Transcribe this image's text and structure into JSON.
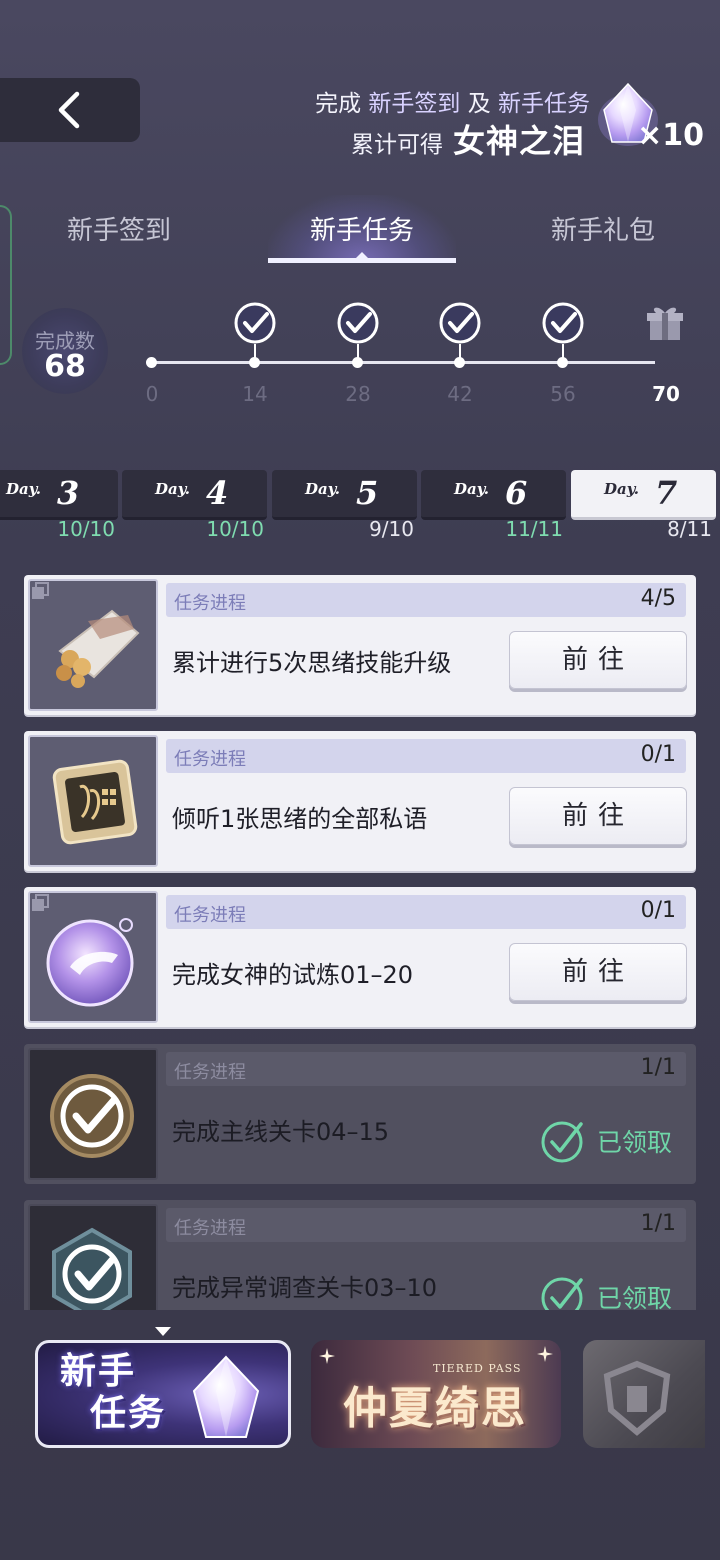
{
  "header": {
    "banner_line1_prefix": "完成",
    "banner_line1_a": "新手签到",
    "banner_line1_and": "及",
    "banner_line1_b": "新手任务",
    "banner_line2_prefix": "累计可得",
    "banner_reward_name": "女神之泪",
    "reward_count": "×10"
  },
  "tabs": [
    {
      "label": "新手签到",
      "active": false
    },
    {
      "label": "新手任务",
      "active": true
    },
    {
      "label": "新手礼包",
      "active": false
    }
  ],
  "progress": {
    "count_label": "完成数",
    "count_value": "68",
    "current": 68,
    "max": 70,
    "milestones": [
      "0",
      "14",
      "28",
      "42",
      "56",
      "70"
    ]
  },
  "days": [
    {
      "word": "Day.",
      "num": "3",
      "progress": "10/10",
      "done": true
    },
    {
      "word": "Day.",
      "num": "4",
      "progress": "10/10",
      "done": true
    },
    {
      "word": "Day.",
      "num": "5",
      "progress": "9/10",
      "done": false
    },
    {
      "word": "Day.",
      "num": "6",
      "progress": "11/11",
      "done": true
    },
    {
      "word": "Day.",
      "num": "7",
      "progress": "8/11",
      "done": false,
      "active": true
    }
  ],
  "tasks": [
    {
      "progress_label": "任务进程",
      "progress": "4/5",
      "title": "累计进行5次思绪技能升级",
      "action": "前往",
      "claimed": false
    },
    {
      "progress_label": "任务进程",
      "progress": "0/1",
      "title": "倾听1张思绪的全部私语",
      "action": "前往",
      "claimed": false
    },
    {
      "progress_label": "任务进程",
      "progress": "0/1",
      "title": "完成女神的试炼01–20",
      "action": "前往",
      "claimed": false
    },
    {
      "progress_label": "任务进程",
      "progress": "1/1",
      "title": "完成主线关卡04–15",
      "action": "已领取",
      "claimed": true
    },
    {
      "progress_label": "任务进程",
      "progress": "1/1",
      "title": "完成异常调查关卡03–10",
      "action": "已领取",
      "claimed": true
    }
  ],
  "events": [
    {
      "title_line1": "新手",
      "title_line2": "任务"
    },
    {
      "subtitle": "TIERED PASS",
      "title": "仲夏绮思"
    }
  ],
  "colors": {
    "accent_green": "#6fd6a8",
    "progress_bar_bg": "#d3d4ec",
    "background": "#3e3d52"
  }
}
